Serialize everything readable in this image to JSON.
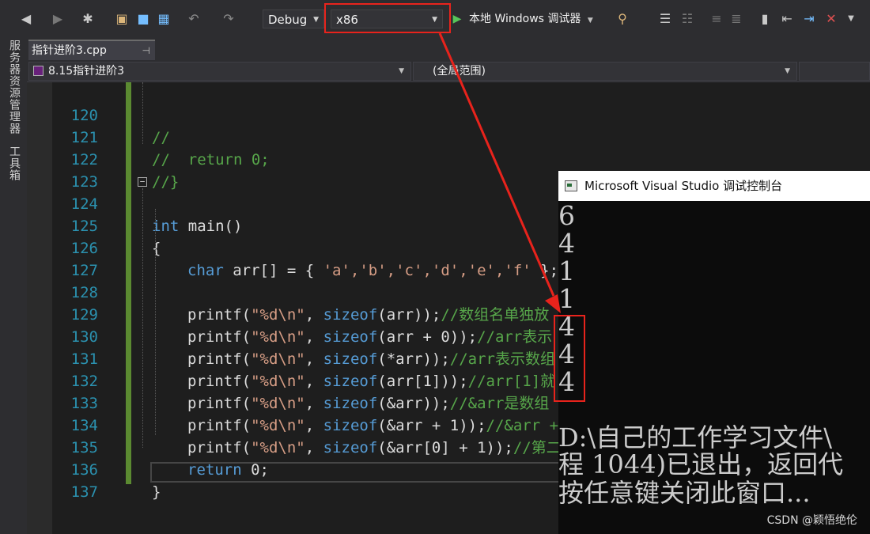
{
  "toolbar": {
    "config": "Debug",
    "platform": "x86",
    "run_label": "本地 Windows 调试器"
  },
  "sidebar": {
    "server_explorer": "服务器资源管理器",
    "toolbox": "工具箱"
  },
  "tab": {
    "title": "指针进阶3.cpp",
    "pin": "⊣"
  },
  "navbar": {
    "project": "8.15指针进阶3",
    "scope": "(全局范围)"
  },
  "editor": {
    "line_numbers": [
      "120",
      "121",
      "122",
      "123",
      "124",
      "125",
      "126",
      "127",
      "128",
      "129",
      "130",
      "131",
      "132",
      "133",
      "134",
      "135",
      "136",
      "137"
    ],
    "l120": "//",
    "l121": "//  return 0;",
    "l122": "//}",
    "l124_kw": "int",
    "l124_rest": " main()",
    "l125": "{",
    "l126_kw": "char",
    "l126_rest": " arr[] = { ",
    "l126_str": "'a','b','c','d','e','f'",
    "l126_end": " };",
    "printf": "printf",
    "fmt": "\"%d\\n\"",
    "sizeof": "sizeof",
    "l128_arg": "(arr));",
    "l128_cm": "//数组名单独放",
    "l129_arg": "(arr + 0));",
    "l129_cm": "//arr表示",
    "l130_arg": "(*arr));",
    "l130_cm": "//arr表示数组",
    "l131_arg": "(arr[1]));",
    "l131_cm": "//arr[1]就",
    "l132_arg": "(&arr));",
    "l132_cm": "//&arr是数组",
    "l133_arg": "(&arr + 1));",
    "l133_cm": "//&arr +",
    "l134_arg": "(&arr[0] + 1));",
    "l134_cm": "//第二",
    "l135_kw": "return",
    "l135_rest": " 0;",
    "l136": "}",
    "collapse": "−"
  },
  "console": {
    "title": "Microsoft Visual Studio 调试控制台",
    "outputs": [
      "6",
      "4",
      "1",
      "1",
      "4",
      "4",
      "4"
    ],
    "msg1": "D:\\自己的工作学习文件\\",
    "msg2": "程 1044)已退出，返回代",
    "msg3": "按任意键关闭此窗口..."
  },
  "watermark": "CSDN @颖悟绝伦",
  "colors": {
    "highlight": "#e8231c",
    "keyword": "#569cd6",
    "comment": "#57a64a",
    "string": "#d69d85",
    "line_number": "#2b91af"
  }
}
